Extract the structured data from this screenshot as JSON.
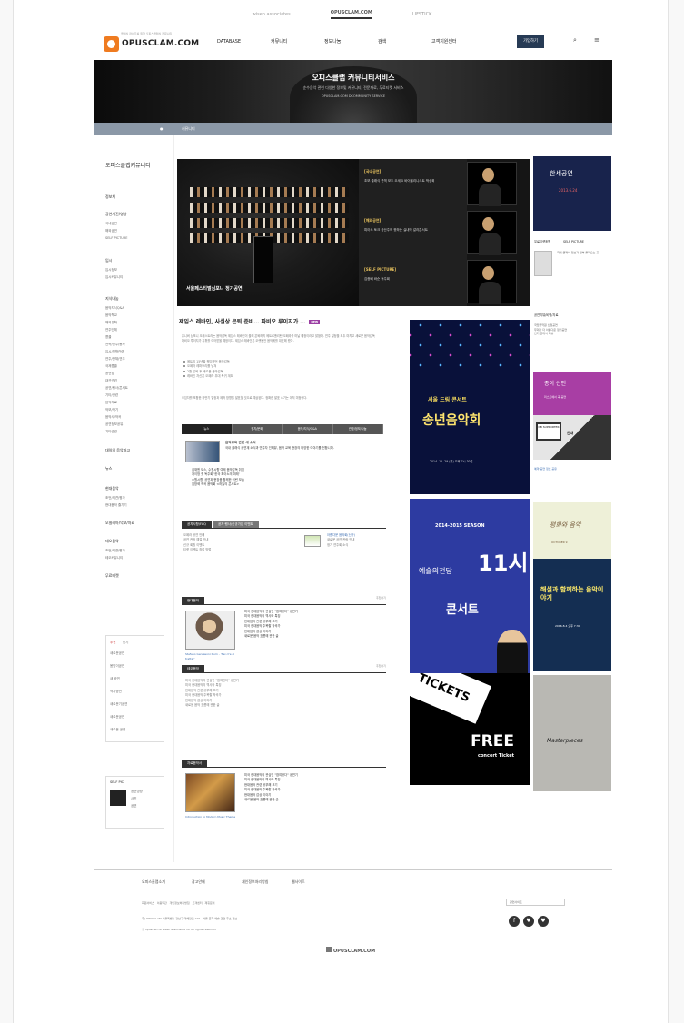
{
  "top_tabs": [
    "wisen associates",
    "OPUSCLAM.COM",
    "LIFSTICK"
  ],
  "brand": {
    "name": "OPUSCLAM.COM",
    "tagline": "클래식 라이프를 위한 오피스클래식 커뮤니티"
  },
  "nav": [
    "DATABASE",
    "커뮤니티",
    "정보나눔",
    "검색",
    "고객지원센터"
  ],
  "join_label": "가입하기",
  "hero": {
    "title": "오피스클랩 커뮤니티서비스",
    "subtitle": "순수음악 관련 다양한 정보및 커뮤니티, 전문자료, 무료티켓 서비스",
    "english": "OPUSCLAM.COM DCOMMUNITY SERVICE"
  },
  "breadcrumb": [
    "커뮤니티"
  ],
  "sidebar": {
    "title": "오피스클랩커뮤니티",
    "sections": [
      {
        "label": "정보체",
        "items": []
      },
      {
        "label": "공연사진/영상",
        "items": [
          "국내공연",
          "해외공연",
          "SELF PICTURE"
        ]
      },
      {
        "label": "입시",
        "items": [
          "입시정보",
          "입시커뮤니티"
        ]
      },
      {
        "label": "지식나눔",
        "items": [
          "음악지식Q&A",
          "음악학교",
          "해외유학",
          "연주단체",
          "콩쿨",
          "전속/연주/봉사",
          "입시/진학관련",
          "연주/단체/연주",
          "국제콩쿨",
          "공연장",
          "대관관련",
          "공연/행사/콘서트",
          "기타/관련",
          "음악자료",
          "악보/악기",
          "음악사/작곡",
          "공연정보공유",
          "기타관련"
        ]
      },
      {
        "label": "대일의 음악파고",
        "items": []
      },
      {
        "label": "뉴스",
        "items": []
      },
      {
        "label": "현대음악",
        "items": [
          "조언/의견/평가",
          "현대음악 즐기기"
        ]
      },
      {
        "label": "오필리아/악보/자료",
        "items": []
      },
      {
        "label": "테오음악",
        "items": [
          "조언/의견/평가",
          "테오커뮤니티"
        ]
      },
      {
        "label": "무료티켓",
        "items": []
      }
    ],
    "block1_tabs": [
      "추천",
      "인기"
    ],
    "block1_items": [
      "새로운공연",
      "봄맞이공연",
      "새 공연",
      "역사공연",
      "새로운기공연",
      "새로운공연",
      "새로운 공연",
      "공연 공지"
    ],
    "block2_title": "SELF PIC",
    "block2_items": [
      "공연영상",
      "사진",
      "공연"
    ]
  },
  "feature": {
    "caption": "서울페스티벌심포니 정기공연",
    "items": [
      {
        "label": "[국내공연]",
        "text": "초보 클래식 관객 모두 오세요 바이올리니스트 박성희"
      },
      {
        "label": "[해외공연]",
        "text": "피아노 토크 공산주의 핫하는 실내악 갈라콘서트"
      },
      {
        "label": "[SELF PICTURE]",
        "text": "김종배 바순 독주회"
      }
    ]
  },
  "headline": "제임스 레바인, 사실상 은퇴 준비… 파비오 루이지가 …",
  "new_badge": "NEW",
  "article_text": "유니버 심포니 오케스트라는 음악감독 제임스 레바인이 올해 은퇴하지 메트로폴리탄 오페라를 떠날 예정이라고 밝혔다. 연주 일정을 모두 마치고 새로운 음악감독 파비오 루이지가 지휘를 이어받을 예정이다. 제임스 레바인은 오랫동안 음악계를 대표해 왔다.",
  "bullets": [
    "메트의 15년을 책임졌던 음악감독",
    "오페라 레퍼토리를 남겨",
    "2월 은퇴 후 새로운 음악감독",
    "레바인 자신은 오페라 무대 복귀 계획"
  ],
  "article_more": "후임자를 포함한 하반기 일정과 제작 방향을 발표할 것으로 예상된다. 정확한 발표 시기는 아직 미정이다.",
  "tabs": [
    "뉴스",
    "정치/문화",
    "음악/지식/Q&A",
    "관광/정보/나눔"
  ],
  "lead_news": {
    "title": "음악교육 관련 새 소식",
    "text": "국내 클래식 공연계 소식과 연주자 인터뷰, 음악 교육 현장의 다양한 이야기를 전합니다."
  },
  "news_items": [
    "김재윈 보스, 수원시향 여제 음악감독 취임",
    "자이방 첫 독주회 '한국 피아노의 미래'",
    "수원시향, 공연과 현장음 함께한 이런 모습",
    "임방혁 작곡 음악회 <하늘의 콘서트>"
  ],
  "notice_tabs": [
    "공지사항/FAQ",
    "공지·행사/신규가입 이벤트"
  ],
  "notice_items": [
    "오페라 공연 안내",
    "공연 관람 예절 안내",
    "신규 회원 이벤트",
    "티켓 이벤트 참여 방법"
  ],
  "notice_side": [
    "아름다운 음악회(신규)",
    "새로운 공연 관람 안내",
    "정기 연주회 소식"
  ],
  "modern": {
    "title": "현대음악",
    "more": "추천하기",
    "caption": "Stefano Gervasoni Dum - 'Nei cl'e al trattar'",
    "items": [
      "미국 현대음악의 관심인 \"참여한다\" 공연기",
      "미국 현대음악의 역사와 특징",
      "현대음악 관련 공부해 보기",
      "미국 현대음악 주목할 작곡가",
      "현대음악 감상 이야기",
      "새로운 음악 흐름에 관한 글"
    ]
  },
  "theo": {
    "title": "테오음악",
    "more": "추천하기",
    "items": [
      "미국 현대음악의 관심인 \"참여한다\" 공연기",
      "미국 현대음악의 역사와 특징",
      "현대음악 관련 공부해 보기",
      "미국 현대음악 주목할 작곡가",
      "현대음악 감상 이야기",
      "새로운 음악 흐름에 관한 글"
    ]
  },
  "introduction": {
    "title": "자료음악서",
    "caption": "Introduction to Modern Music Theme",
    "items": [
      "미국 현대음악의 관심인 \"참여한다\" 공연기",
      "미국 현대음악의 역사와 특징",
      "현대음악 관련 공부해 보기",
      "미국 현대음악 주목할 작곡가",
      "현대음악 감상 이야기",
      "새로운 음악 흐름에 관한 글"
    ]
  },
  "ads": {
    "center": [
      {
        "title": "서울 드림 콘서트",
        "main": "송년음악회",
        "sub": "2014. 12. 29 (월) 오후 7시 30분"
      },
      {
        "title": "2014-2015 SEASON",
        "main": "11시",
        "subtitle": "예술의전당",
        "bottom": "콘서트"
      },
      {
        "title": "TICKETS",
        "free": "FREE",
        "small": "concert Ticket"
      }
    ],
    "right": [
      {
        "title": "한세공연",
        "sub": "2013.6.24"
      },
      {
        "title": "종이 신인",
        "sub": "리스트에서 곡 공연"
      },
      {
        "title": "DB SUPPORTER",
        "sub": "안내"
      },
      {
        "title": "평화와 음악",
        "sub": "OCTOBER 9"
      },
      {
        "title": "해설과 함께하는 음악이야기",
        "sub": "2016.8.4 오후 7:30"
      },
      {
        "title": "Masterpieces",
        "sub": ""
      }
    ]
  },
  "right_text": [
    {
      "title": "무료티켓후원",
      "links": [
        "SELF PICTURE"
      ]
    },
    {
      "title": "공연리뷰/비평/자료",
      "links": [
        "국립국악원 신정공연",
        "무대가 더 아름다운 정기공연",
        "인기 클래식 리뷰"
      ]
    }
  ],
  "right_notice": [
    "국내 클래식 정보가 전부 올라오는 곳",
    "예약·공연 정보 공유"
  ],
  "footer": {
    "menu": [
      "오피스클랩소개",
      "광고안내",
      "개인정보처리방침",
      "웹사이트"
    ],
    "links": [
      "회원서비스",
      "이용약관",
      "개인정보처리방침",
      "고객센터",
      "제휴문의"
    ],
    "company": "주) OPUSCLAM 서울특별시 강남구 테헤란로 215 - 서울 문화 예술 관련 주소 정보",
    "copyright": "ⓒ opusclam & wisen associates lnc All rights reserved",
    "select_value": "관련사이트",
    "social": [
      "f",
      "♥",
      "♥"
    ],
    "logo": "OPUSCLAM.COM"
  }
}
